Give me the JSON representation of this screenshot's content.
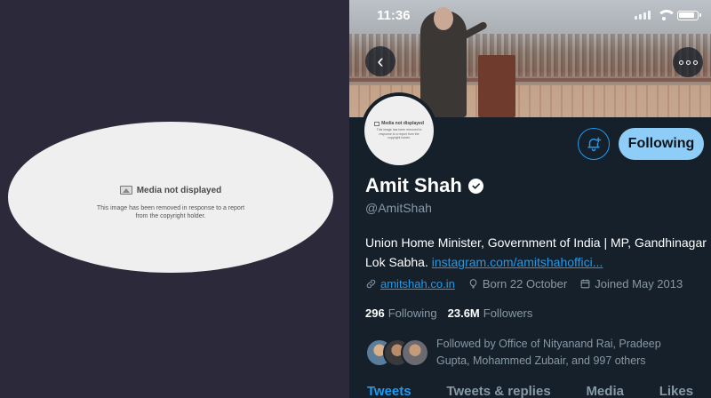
{
  "left_panel": {
    "media_title": "Media not displayed",
    "media_text": "This image has been removed in response to a report from the copyright holder."
  },
  "status_bar": {
    "time": "11:36",
    "icons": [
      "signal-icon",
      "wifi-icon",
      "battery-icon"
    ]
  },
  "avatar": {
    "media_title": "Media not displayed",
    "media_text": "This image has been removed in response to a report from the copyright holder."
  },
  "profile": {
    "name": "Amit Shah",
    "handle": "@AmitShah",
    "bio_text": "Union Home Minister, Government of India | MP, Gandhinagar Lok Sabha.",
    "bio_link": "instagram.com/amitshahoffici...",
    "website": "amitshah.co.in",
    "born": "Born 22 October",
    "joined": "Joined May 2013",
    "following_count": "296",
    "following_label": "Following",
    "followers_count": "23.6M",
    "followers_label": "Followers",
    "followed_by": "Followed by Office of Nityanand Rai, Pradeep Gupta, Mohammed Zubair, and 997 others"
  },
  "buttons": {
    "follow_label": "Following",
    "back": "‹"
  },
  "tabs": [
    {
      "label": "Tweets",
      "active": true
    },
    {
      "label": "Tweets & replies",
      "active": false
    },
    {
      "label": "Media",
      "active": false
    },
    {
      "label": "Likes",
      "active": false
    }
  ],
  "colors": {
    "accent": "#1d9bf0",
    "background": "#15202b",
    "follow_button": "#8ecdf8",
    "left_background": "#2c2a3a"
  }
}
